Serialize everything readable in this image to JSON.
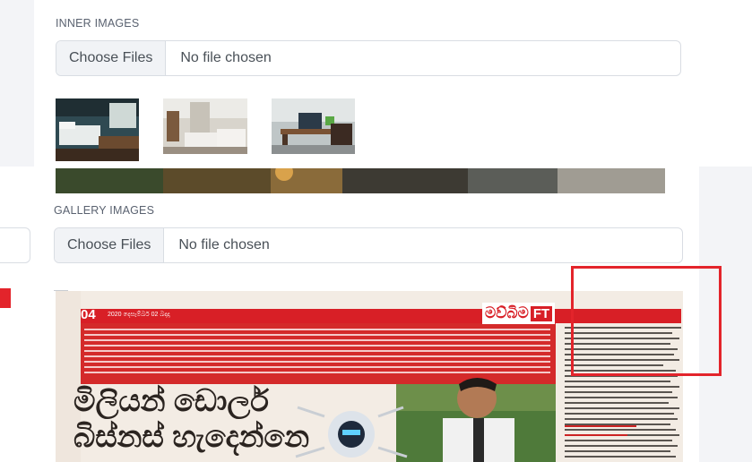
{
  "inner_images": {
    "label": "INNER IMAGES",
    "choose_label": "Choose Files",
    "status": "No file chosen",
    "thumbnails": [
      "bedroom-thumbnail",
      "room-beds-thumbnail",
      "office-desk-thumbnail"
    ]
  },
  "gallery_images": {
    "label": "GALLERY IMAGES",
    "choose_label": "Choose Files",
    "status": "No file chosen"
  },
  "newspaper": {
    "page_number": "04",
    "date_line": "2020 දෙසැම්බර් 02 බදාදා",
    "brand": "මව්බිම",
    "brand_badge": "FT",
    "headline_line1": "මිලියන් ඩොලර්",
    "headline_line2": "බිස්නස් හැදෙන්නෙ"
  },
  "colors": {
    "highlight_box": "#e3242b",
    "newspaper_red": "#d81f26"
  }
}
